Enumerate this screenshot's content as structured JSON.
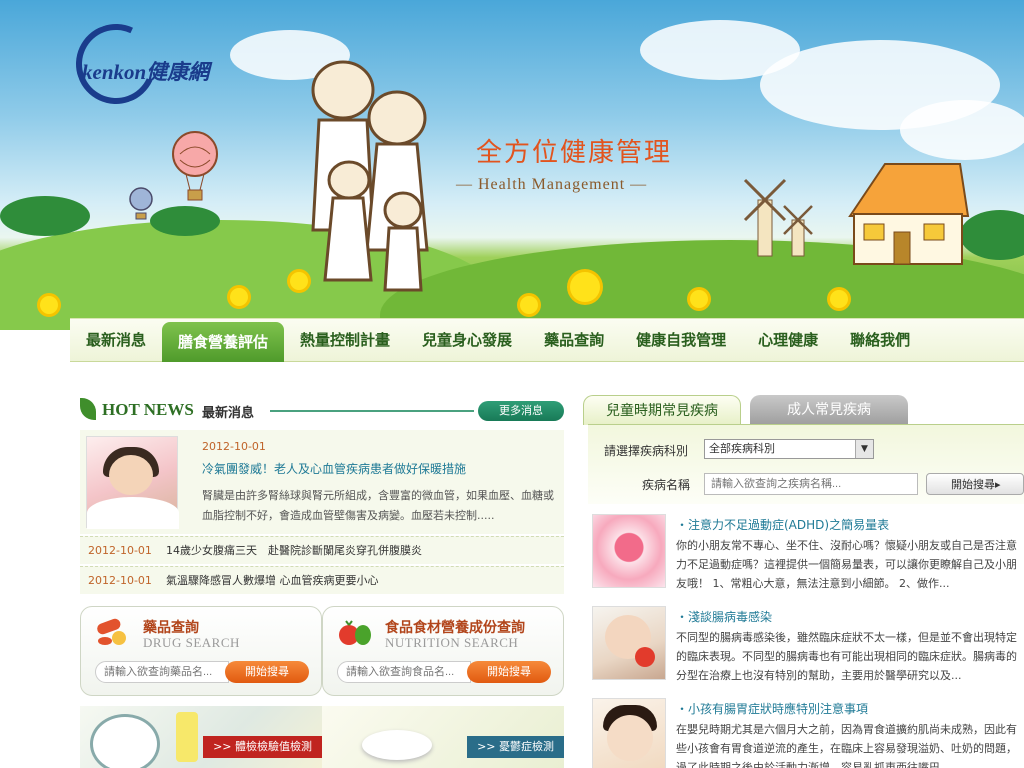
{
  "brand": {
    "logo_text": "kenkon健康網",
    "slogan_cn": "全方位健康管理",
    "slogan_en": "— Health Management —"
  },
  "nav": {
    "items": [
      "最新消息",
      "膳食營養評估",
      "熱量控制計畫",
      "兒童身心發展",
      "藥品查詢",
      "健康自我管理",
      "心理健康",
      "聯絡我們"
    ],
    "active_index": 1
  },
  "news": {
    "heading_en": "HOT NEWS",
    "heading_cn": "最新消息",
    "more_label": "更多消息",
    "feature": {
      "date": "2012-10-01",
      "title": "冷氣團發威！老人及心血管疾病患者做好保暖措施",
      "summary": "腎臟是由許多腎絲球與腎元所組成，含豐富的微血管，如果血壓、血糖或血脂控制不好，會造成血管壁傷害及病變。血壓若未控制....."
    },
    "items": [
      {
        "date": "2012-10-01",
        "title": "14歲少女腹痛三天　赴醫院診斷闌尾炎穿孔併腹膜炎"
      },
      {
        "date": "2012-10-01",
        "title": "氣溫驟降感冒人數爆增 心血管疾病更要小心"
      }
    ]
  },
  "drug_search": {
    "title_cn": "藥品查詢",
    "title_en": "DRUG SEARCH",
    "placeholder": "請輸入欲查詢藥品名...",
    "button": "開始搜尋"
  },
  "nutrition_search": {
    "title_cn": "食品食材營養成份查詢",
    "title_en": "NUTRITION SEARCH",
    "placeholder": "請輸入欲查詢食品名...",
    "button": "開始搜尋"
  },
  "promos": [
    {
      "label": ">> 體檢檢驗值檢測"
    },
    {
      "label": ">> 憂鬱症檢測"
    }
  ],
  "disease": {
    "tabs": [
      "兒童時期常見疾病",
      "成人常見疾病"
    ],
    "active_tab": 0,
    "dept_label": "請選擇疾病科別",
    "dept_value": "全部疾病科別",
    "name_label": "疾病名稱",
    "name_placeholder": "請輸入欲查詢之疾病名稱...",
    "search_button": "開始搜尋▸"
  },
  "articles": [
    {
      "title": "・注意力不足過動症(ADHD)之簡易量表",
      "summary": "你的小朋友常不專心、坐不住、沒耐心嗎？懷疑小朋友或自己是否注意力不足過動症嗎？這裡提供一個簡易量表，可以讓你更瞭解自己及小朋友哦！ 1、常粗心大意，無法注意到小細節。 2、做作..."
    },
    {
      "title": "・淺談腸病毒感染",
      "summary": "不同型的腸病毒感染後，雖然臨床症狀不太一樣，但是並不會出現特定的臨床表現。不同型的腸病毒也有可能出現相同的臨床症狀。腸病毒的分型在治療上也沒有特別的幫助，主要用於醫學研究以及..."
    },
    {
      "title": "・小孩有腸胃症狀時應特別注意事項",
      "summary": "在嬰兒時期尤其是六個月大之前，因為胃食道擴約肌尚未成熟，因此有些小孩會有胃食道逆流的產生，在臨床上容易發現溢奶、吐奶的問題，過了此時期之後由於活動力漸增，容易亂抓東西往嘴巴"
    }
  ]
}
